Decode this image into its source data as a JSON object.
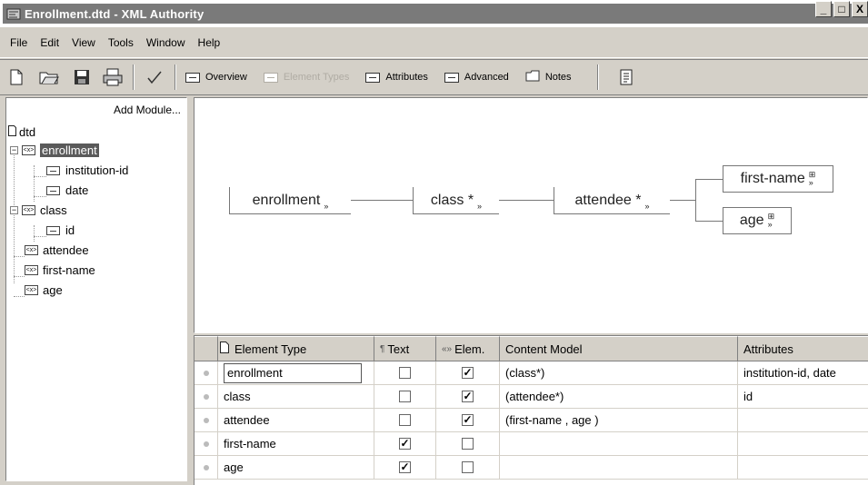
{
  "window": {
    "title": "Enrollment.dtd - XML Authority",
    "min": "_",
    "max": "□",
    "close": "X"
  },
  "menu": {
    "items": [
      "File",
      "Edit",
      "View",
      "Tools",
      "Window",
      "Help"
    ]
  },
  "toolbar": {
    "tabs": {
      "overview": "Overview",
      "element_types": "Element Types",
      "attributes": "Attributes",
      "advanced": "Advanced",
      "notes": "Notes"
    }
  },
  "tree": {
    "add_module": "Add Module...",
    "root": "dtd",
    "nodes": {
      "enrollment": "enrollment",
      "institution_id": "institution-id",
      "date": "date",
      "class": "class",
      "id": "id",
      "attendee": "attendee",
      "first_name": "first-name",
      "age": "age"
    },
    "elem_glyph": "<x>"
  },
  "diagram": {
    "nodes": {
      "enrollment": "enrollment",
      "class": "class *",
      "attendee": "attendee *",
      "first_name": "first-name",
      "age": "age"
    },
    "chevron": "»",
    "expand_glyph": "⊞"
  },
  "grid": {
    "headers": {
      "element_type": "Element Type",
      "text": "Text",
      "elem": "Elem.",
      "content_model": "Content Model",
      "attributes": "Attributes"
    },
    "rows": [
      {
        "element_type": "enrollment",
        "text": false,
        "elem": true,
        "content_model": "(class*)",
        "attributes": "institution-id, date"
      },
      {
        "element_type": "class",
        "text": false,
        "elem": true,
        "content_model": "(attendee*)",
        "attributes": "id"
      },
      {
        "element_type": "attendee",
        "text": false,
        "elem": true,
        "content_model": "(first-name , age )",
        "attributes": ""
      },
      {
        "element_type": "first-name",
        "text": true,
        "elem": false,
        "content_model": "",
        "attributes": ""
      },
      {
        "element_type": "age",
        "text": true,
        "elem": false,
        "content_model": "",
        "attributes": ""
      }
    ]
  },
  "check_mark": "✓",
  "colors": {
    "chrome": "#d4d0c8",
    "titlebar": "#7a7a7a",
    "selection": "#5a5a5a"
  }
}
